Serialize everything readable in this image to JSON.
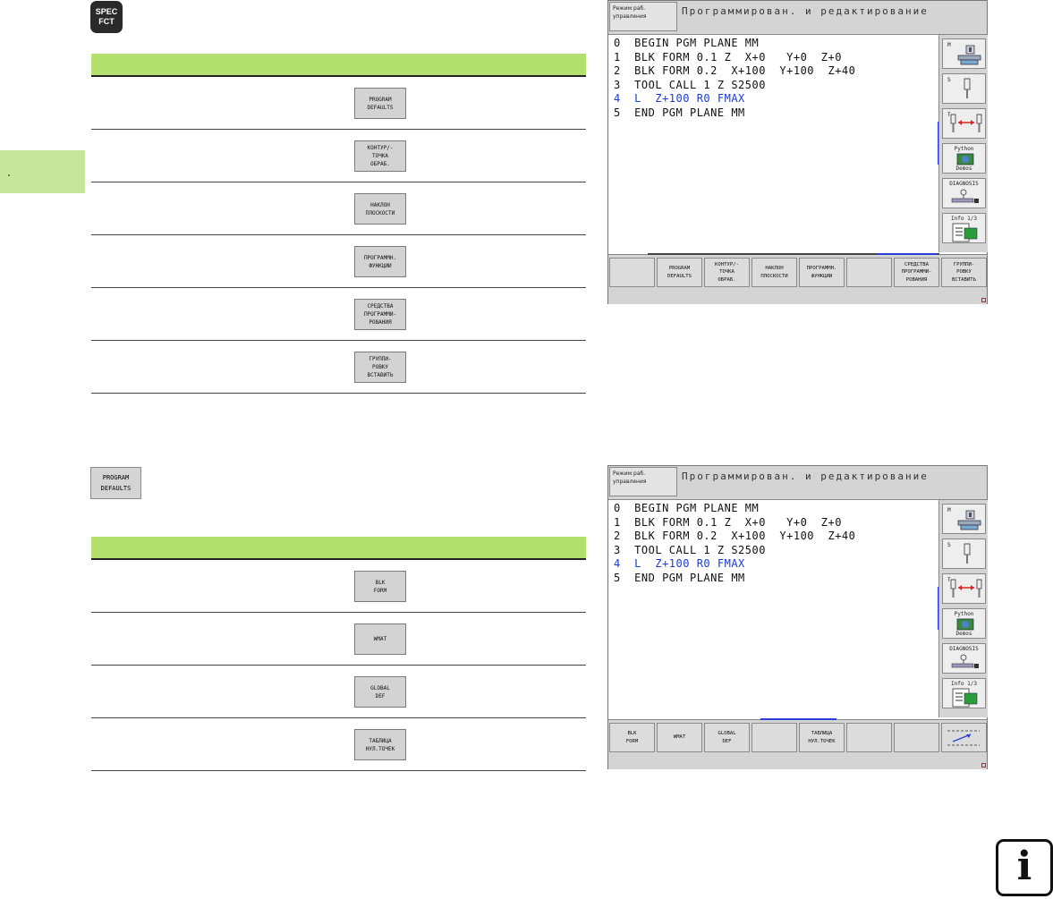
{
  "spec_fct_key": {
    "line1": "SPEC",
    "line2": "FCT"
  },
  "table1": {
    "rows": [
      {
        "lines": [
          "PROGRAM",
          "DEFAULTS"
        ]
      },
      {
        "lines": [
          "КОНТУР/-",
          "ТОЧКА",
          "ОБРАБ."
        ]
      },
      {
        "lines": [
          "НАКЛОН",
          "ПЛОСКОСТИ"
        ]
      },
      {
        "lines": [
          "ПРОГРАММН.",
          "ФУНКЦИИ"
        ]
      },
      {
        "lines": [
          "СРЕДСТВА",
          "ПРОГРАММИ-",
          "РОВАНИЯ"
        ]
      },
      {
        "lines": [
          "ГРУППИ-",
          "РОВКУ",
          "ВСТАВИТЬ"
        ]
      }
    ]
  },
  "program_defaults_key": {
    "line1": "PROGRAM",
    "line2": "DEFAULTS"
  },
  "table2": {
    "rows": [
      {
        "lines": [
          "BLK",
          "FORM"
        ]
      },
      {
        "lines": [
          "WMAT"
        ]
      },
      {
        "lines": [
          "GLOBAL",
          "DEF"
        ]
      },
      {
        "lines": [
          "ТАБЛИЦА",
          "НУЛ.ТОЧЕК"
        ]
      }
    ]
  },
  "screen": {
    "mode_line1": "Режим раб.",
    "mode_line2": "управления",
    "title": "Программирован. и редактирование",
    "program_lines": [
      "0  BEGIN PGM PLANE MM",
      "1  BLK FORM 0.1 Z  X+0   Y+0  Z+0",
      "2  BLK FORM 0.2  X+100  Y+100  Z+40",
      "3  TOOL CALL 1 Z S2500",
      "4  L  Z+100 R0 FMAX",
      "5  END PGM PLANE MM"
    ],
    "right_keys": {
      "m": "M",
      "s": "S",
      "t": "T",
      "python_top": "Python",
      "python_bottom": "Demos",
      "diagnosis": "DIAGNOSIS",
      "info": "Info 1/3"
    }
  },
  "screen1_softkeys": [
    [
      ""
    ],
    [
      "PROGRAM",
      "DEFAULTS"
    ],
    [
      "КОНТУР/-",
      "ТОЧКА",
      "ОБРАБ."
    ],
    [
      "НАКЛОН",
      "ПЛОСКОСТИ"
    ],
    [
      "ПРОГРАММН.",
      "ФУНКЦИИ"
    ],
    [
      ""
    ],
    [
      "СРЕДСТВА",
      "ПРОГРАММИ-",
      "РОВАНИЯ"
    ],
    [
      "ГРУППИ-",
      "РОВКУ",
      "ВСТАВИТЬ"
    ]
  ],
  "screen2_softkeys": [
    [
      "BLK",
      "FORM"
    ],
    [
      "WMAT"
    ],
    [
      "GLOBAL",
      "DEF"
    ],
    [
      ""
    ],
    [
      "ТАБЛИЦА",
      "НУЛ.ТОЧЕК"
    ],
    [
      ""
    ],
    [
      ""
    ],
    [
      "scroll-arrow"
    ]
  ],
  "info_icon": "i"
}
